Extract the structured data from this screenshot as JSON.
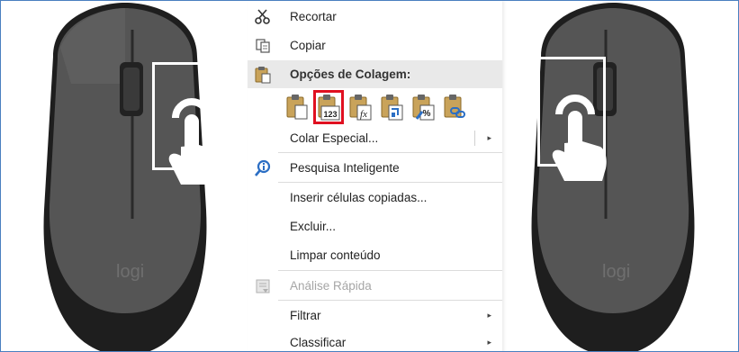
{
  "menu": {
    "items": [
      {
        "id": "cut",
        "label": "Recortar",
        "icon": "scissors-icon"
      },
      {
        "id": "copy",
        "label": "Copiar",
        "icon": "copy-icon"
      },
      {
        "id": "paste_options",
        "label": "Opções de Colagem:",
        "icon": "clipboard-icon"
      },
      {
        "id": "paste_special",
        "label": "Colar Especial...",
        "arrow": "▸"
      },
      {
        "id": "smart_lookup",
        "label": "Pesquisa Inteligente",
        "icon": "smart-lookup-icon"
      },
      {
        "id": "insert_copied",
        "label": "Inserir células copiadas..."
      },
      {
        "id": "delete",
        "label": "Excluir..."
      },
      {
        "id": "clear",
        "label": "Limpar conteúdo"
      },
      {
        "id": "quick_analysis",
        "label": "Análise Rápida",
        "icon": "quick-analysis-icon",
        "disabled": true
      },
      {
        "id": "filter",
        "label": "Filtrar",
        "arrow": "▸"
      },
      {
        "id": "sort",
        "label": "Classificar",
        "arrow": "▸"
      }
    ],
    "paste_buttons": [
      {
        "name": "paste-button",
        "icon": "paste-icon"
      },
      {
        "name": "paste-values-button",
        "icon": "paste-values-icon",
        "text": "123",
        "selected": true
      },
      {
        "name": "paste-formulas-button",
        "icon": "paste-formulas-icon",
        "text": "fx"
      },
      {
        "name": "paste-transpose-button",
        "icon": "paste-transpose-icon"
      },
      {
        "name": "paste-formatting-button",
        "icon": "paste-formatting-icon",
        "text": "%"
      },
      {
        "name": "paste-link-button",
        "icon": "paste-link-icon"
      }
    ]
  },
  "mice": {
    "brand": "logi"
  },
  "colors": {
    "mouse_body": "#4d4d4d",
    "mouse_dark": "#1c1c1c",
    "menu_header": "#e9e9e9",
    "selected_outline": "#e01020",
    "frame_border": "#4a7fc0"
  }
}
